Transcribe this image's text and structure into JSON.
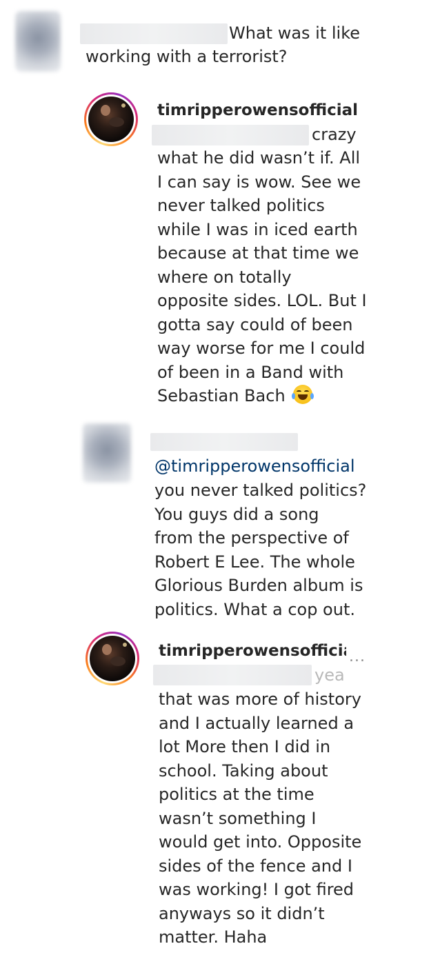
{
  "comments": [
    {
      "text_lines": [
        "What was it like",
        "working with a terrorist?"
      ]
    },
    {
      "username": "timripperowensofficial",
      "text_lines": [
        "crazy",
        "what he did wasn’t if. All",
        "I can say is wow. See we",
        "never talked politics",
        "while I was in iced earth",
        "because at that time we",
        "where on totally",
        "opposite sides. LOL. But I",
        "gotta say could of been",
        "way worse for me I could",
        "of been in a Band with",
        "Sebastian Bach"
      ],
      "emoji": "face-with-tears-of-joy-icon"
    },
    {
      "mention": "@timripperowensofficial",
      "text_lines": [
        "you never talked politics?",
        "You guys did a song",
        "from the perspective of",
        "Robert E Lee. The whole",
        "Glorious Burden album is",
        "politics. What a cop out."
      ]
    },
    {
      "username": "timripperowensofficial",
      "more_label": "...",
      "text_lines": [
        "yea",
        "that was more of history",
        "and I actually learned a",
        "lot More then I did in",
        "school. Taking about",
        "politics at the time",
        "wasn’t something I",
        "would get into. Opposite",
        "sides of the fence and I",
        "was working! I got fired",
        "anyways so it didn’t",
        "matter. Haha"
      ]
    }
  ]
}
